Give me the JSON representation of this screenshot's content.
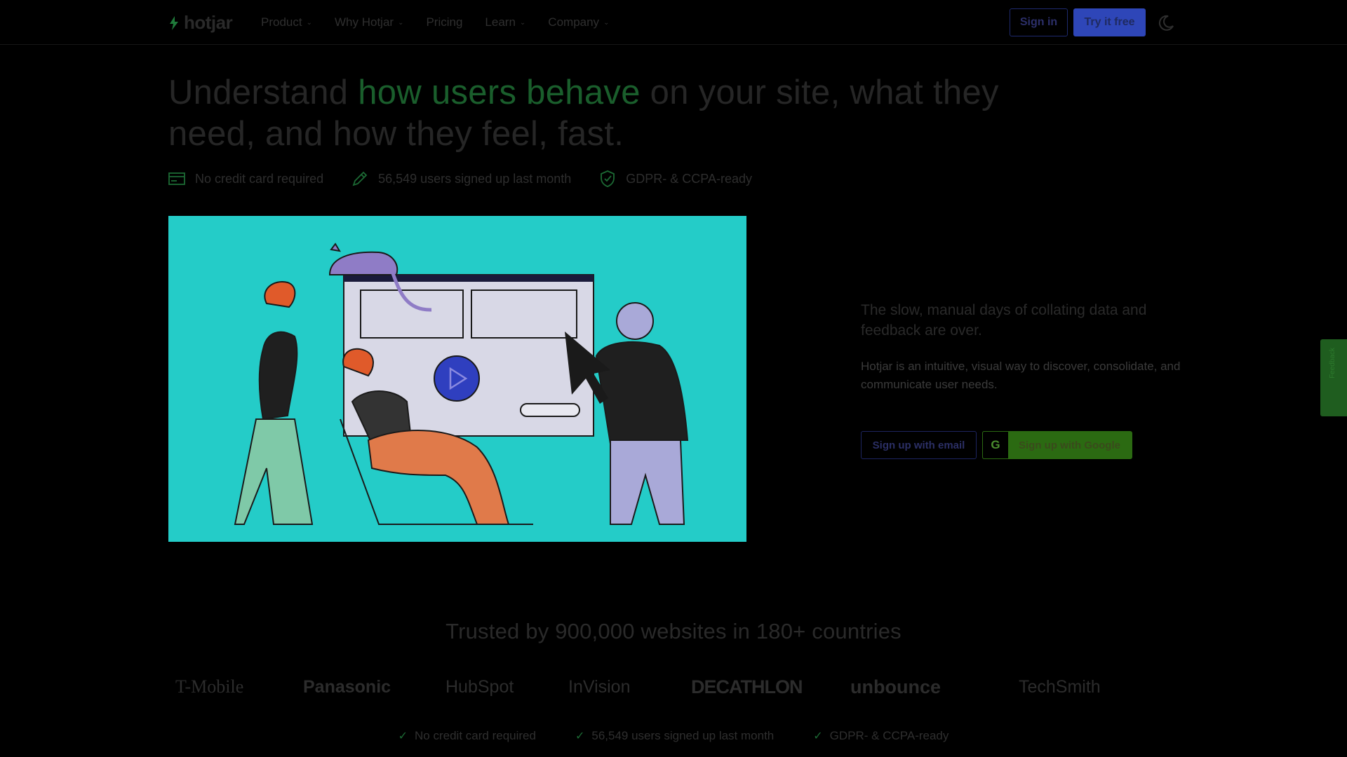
{
  "nav": {
    "brand": "hotjar",
    "items": [
      {
        "label": "Product",
        "dropdown": true
      },
      {
        "label": "Why Hotjar",
        "dropdown": true
      },
      {
        "label": "Pricing",
        "dropdown": false
      },
      {
        "label": "Learn",
        "dropdown": true
      },
      {
        "label": "Company",
        "dropdown": true
      }
    ],
    "signin_label": "Sign in",
    "try_label": "Try it free",
    "theme_icon": "moon-icon"
  },
  "hero": {
    "headline_pre": "Understand ",
    "headline_highlight": "how users behave",
    "headline_post": " on your site, what they need, and how they feel, fast.",
    "badges": [
      {
        "icon": "credit-card-icon",
        "text": "No credit card required"
      },
      {
        "icon": "pencil-icon",
        "text": "56,549 users signed up last month"
      },
      {
        "icon": "shield-check-icon",
        "text": "GDPR- & CCPA-ready"
      }
    ],
    "lead": "The slow, manual days of collating data and feedback are over.",
    "sub": "Hotjar is an intuitive, visual way to discover, consolidate, and communicate user needs.",
    "email_cta": "Sign up with email",
    "google_cta": "Sign up with Google",
    "google_letter": "G"
  },
  "feedback_tab": "Feedback",
  "trusted": {
    "title": "Trusted by 900,000 websites in 180+ countries",
    "logos": [
      "T-Mobile",
      "Panasonic",
      "HubSpot",
      "InVision",
      "DECATHLON",
      "unbounce",
      "TechSmith"
    ]
  },
  "bottom_checks": [
    "No credit card required",
    "56,549 users signed up last month",
    "GDPR- & CCPA-ready"
  ],
  "colors": {
    "accent_green": "#1a5e2c",
    "primary_blue": "#2e46b8",
    "hero_bg": "#24ccc8",
    "google_green": "#2b6a12"
  }
}
